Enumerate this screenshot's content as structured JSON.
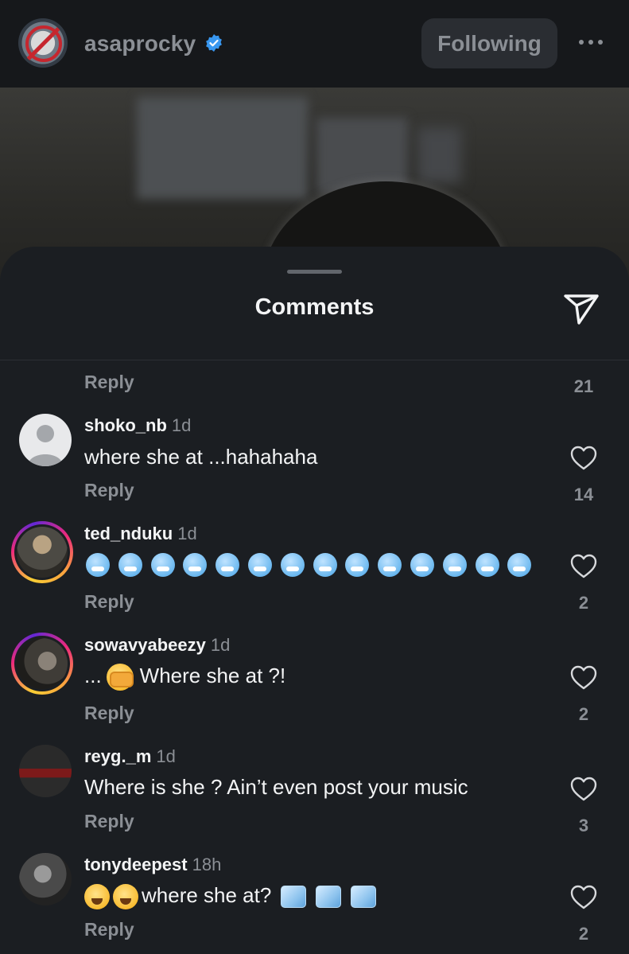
{
  "header": {
    "username": "asaprocky",
    "follow_label": "Following"
  },
  "sheet": {
    "title": "Comments"
  },
  "prev_comment": {
    "reply_label": "Reply",
    "likes": "21"
  },
  "comments": [
    {
      "username": "shoko_nb",
      "time": "1d",
      "text": "where she at ...hahahaha",
      "reply_label": "Reply",
      "likes": "14"
    },
    {
      "username": "ted_nduku",
      "time": "1d",
      "text": "",
      "emoji": "freezing-face-emoji x14",
      "reply_label": "Reply",
      "likes": "2"
    },
    {
      "username": "sowavyabeezy",
      "time": "1d",
      "text_prefix": "...",
      "text": "Where she at ?!",
      "reply_label": "Reply",
      "likes": "2"
    },
    {
      "username": "reyg._m",
      "time": "1d",
      "text": "Where is she ? Ain’t even post your music",
      "reply_label": "Reply",
      "likes": "3"
    },
    {
      "username": "tonydeepest",
      "time": "18h",
      "text": "where she at?",
      "reply_label": "Reply",
      "likes": "2"
    }
  ],
  "colors": {
    "background": "#1b1e22",
    "topbar": "#16181b",
    "muted_text": "#8b8f95",
    "verified": "#3897f0"
  }
}
